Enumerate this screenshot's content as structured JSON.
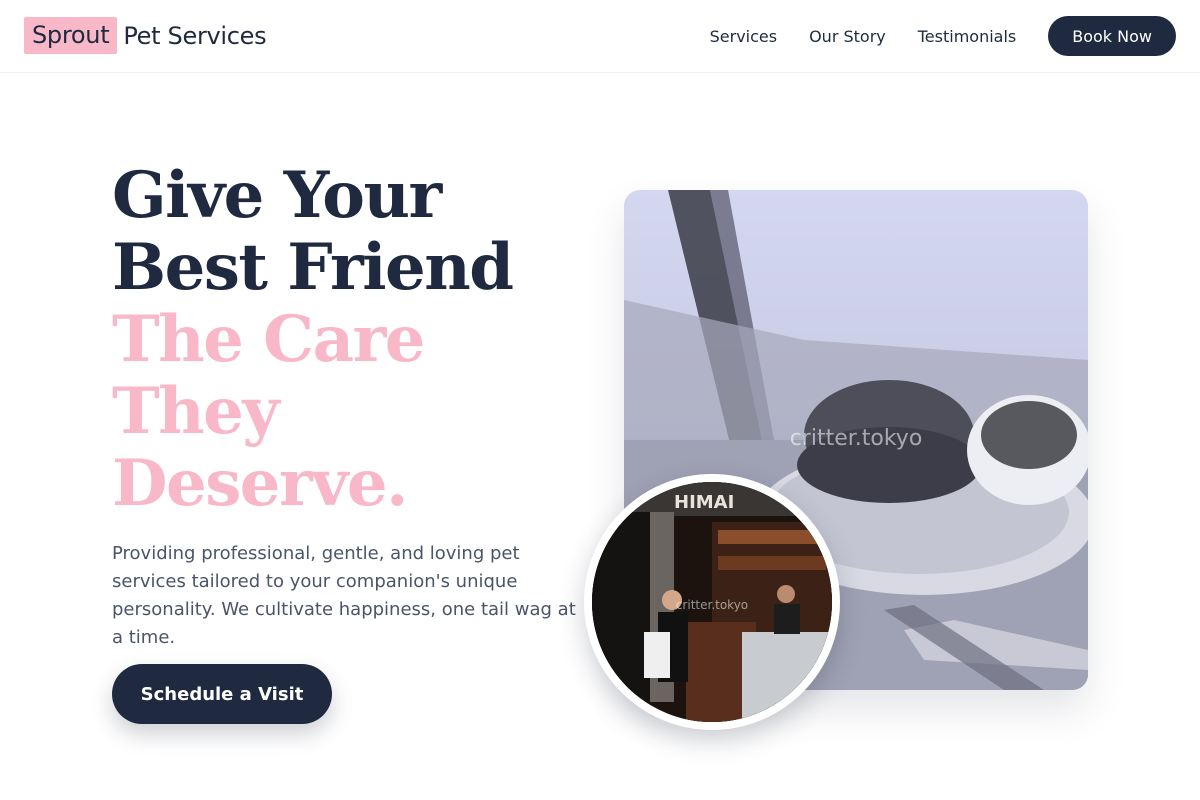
{
  "header": {
    "logo_accent": "Sprout",
    "logo_rest": "Pet Services",
    "nav": [
      {
        "label": "Services"
      },
      {
        "label": "Our Story"
      },
      {
        "label": "Testimonials"
      }
    ],
    "cta_label": "Book Now"
  },
  "hero": {
    "headline_dark_1": "Give Your",
    "headline_dark_2": "Best Friend",
    "headline_pink_1": "The Care",
    "headline_pink_2": "They",
    "headline_pink_3": "Deserve.",
    "lede": "Providing professional, gentle, and loving pet services tailored to your companion's unique personality. We cultivate happiness, one tail wag at a time.",
    "button_label": "Schedule a Visit"
  },
  "images": {
    "main_watermark": "critter.tokyo",
    "inset_watermark": "critter.tokyo"
  },
  "colors": {
    "accent_pink": "#f8b8c8",
    "navy": "#1f2a40",
    "body_text": "#4a5568"
  }
}
